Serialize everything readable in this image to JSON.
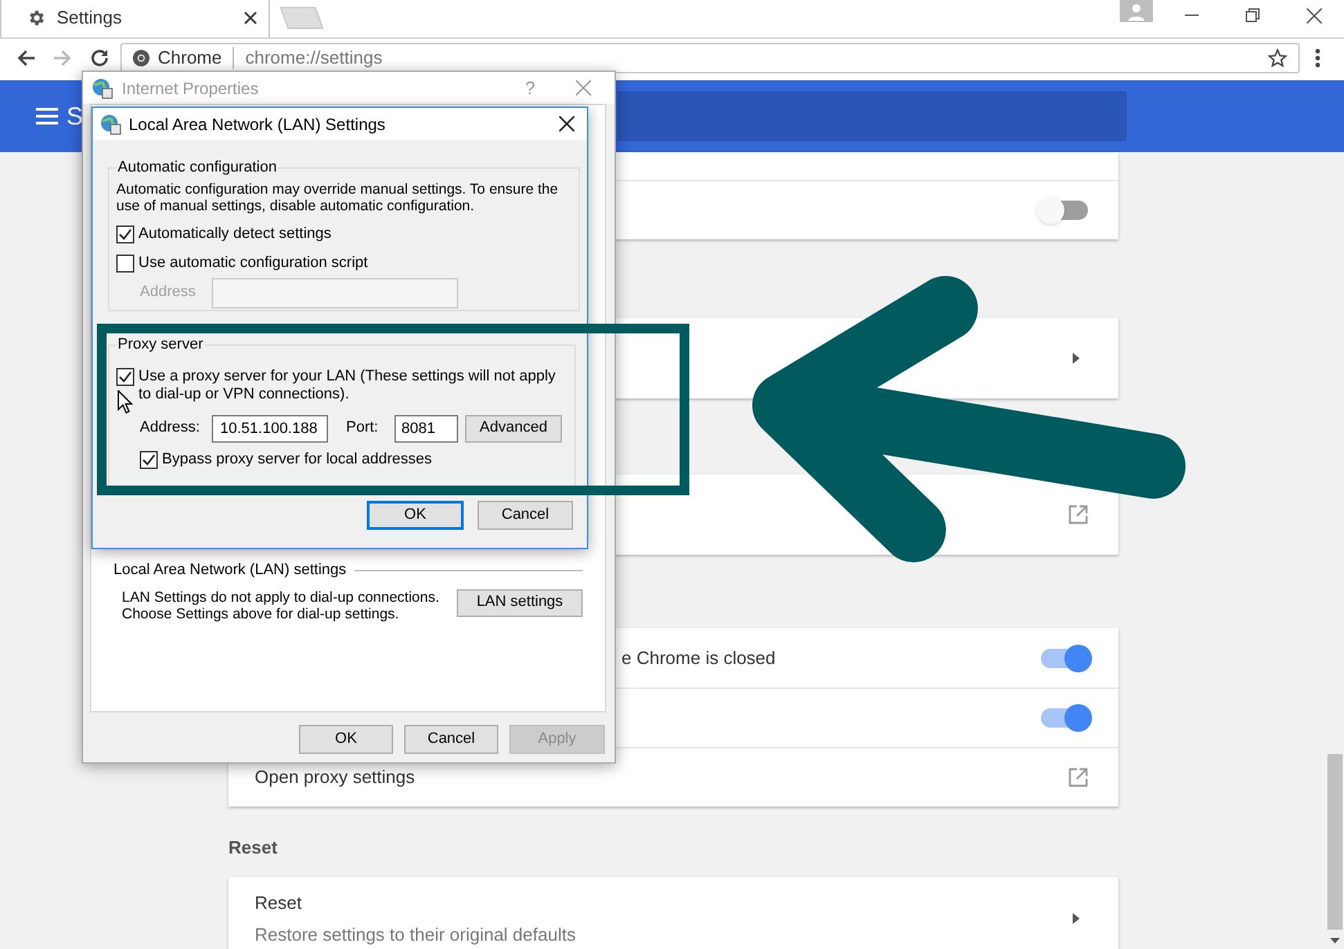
{
  "browser": {
    "tab": {
      "title": "Settings"
    },
    "omnibox": {
      "site": "Chrome",
      "url": "chrome://settings"
    }
  },
  "settings_header": {
    "title_visible": "S"
  },
  "settings_sections": [
    {
      "rows": [
        {
          "kind": "blank"
        },
        {
          "kind": "toggle",
          "on": false
        }
      ]
    },
    {
      "rows": [
        {
          "kind": "submenu"
        }
      ]
    },
    {
      "rows": [
        {
          "kind": "external"
        }
      ]
    },
    {
      "rows": [
        {
          "kind": "toggle",
          "label": "e Chrome is closed",
          "on": true
        },
        {
          "kind": "toggle",
          "on": true
        },
        {
          "kind": "external",
          "label": "Open proxy settings"
        }
      ]
    },
    {
      "heading": "Reset",
      "rows": [
        {
          "kind": "submenu",
          "label": "Reset",
          "sublabel": "Restore settings to their original defaults"
        }
      ]
    }
  ],
  "internet_properties": {
    "title": "Internet Properties",
    "active": false,
    "help": "?",
    "lan_group": {
      "title": "Local Area Network (LAN) settings",
      "description": "LAN Settings do not apply to dial-up connections. Choose Settings above for dial-up settings.",
      "button": "LAN settings"
    },
    "buttons": [
      {
        "label": "OK",
        "disabled": false
      },
      {
        "label": "Cancel",
        "disabled": false
      },
      {
        "label": "Apply",
        "disabled": true
      }
    ]
  },
  "lan_settings": {
    "title": "Local Area Network (LAN) Settings",
    "active": true,
    "automatic_configuration": {
      "title": "Automatic configuration",
      "description": "Automatic configuration may override manual settings.  To ensure the use of manual settings, disable automatic configuration.",
      "options": [
        {
          "label": "Automatically detect settings",
          "checked": true
        },
        {
          "label": "Use automatic configuration script",
          "checked": false
        }
      ],
      "address": {
        "label": "Address",
        "disabled": true
      }
    },
    "proxy_server": {
      "title": "Proxy server",
      "use_proxy": {
        "label": "Use a proxy server for your LAN (These settings will not apply to dial-up or VPN connections).",
        "checked": true
      },
      "address": {
        "label": "Address:",
        "value": "10.51.100.188"
      },
      "port": {
        "label": "Port:",
        "value": "8081"
      },
      "advanced_button": "Advanced",
      "bypass": {
        "label": "Bypass proxy server for local addresses",
        "checked": true
      }
    },
    "buttons": [
      {
        "label": "OK",
        "default": true
      },
      {
        "label": "Cancel",
        "default": false
      }
    ]
  }
}
